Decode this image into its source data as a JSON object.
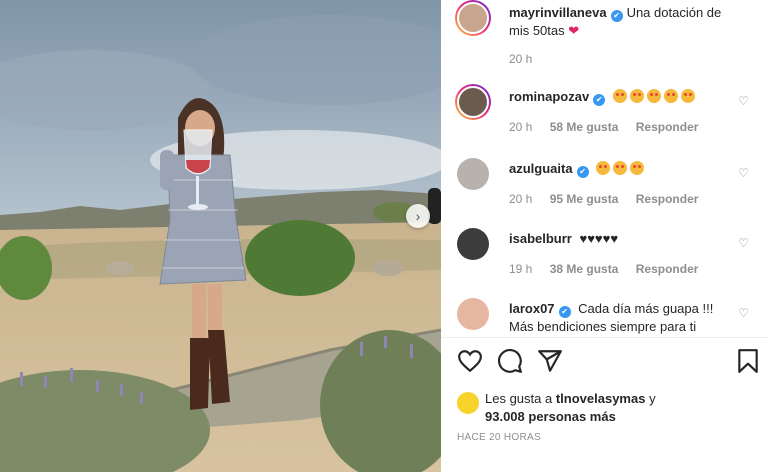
{
  "post": {
    "author": "mayrinvillaneva",
    "caption": "Una dotación de mis 50tas",
    "caption_emoji": "❤",
    "time": "20 h"
  },
  "comments": [
    {
      "user": "rominapozav",
      "text": "",
      "emoji_count": 5,
      "time": "20 h",
      "likes": "58 Me gusta",
      "reply": "Responder"
    },
    {
      "user": "azulguaita",
      "text": "",
      "emoji_count": 3,
      "time": "20 h",
      "likes": "95 Me gusta",
      "reply": "Responder"
    },
    {
      "user": "isabelburr",
      "text": "♥♥♥♥♥",
      "emoji_count": 0,
      "time": "19 h",
      "likes": "38 Me gusta",
      "reply": "Responder"
    },
    {
      "user": "larox07",
      "text": "Cada día más guapa !!! Más bendiciones siempre para ti",
      "emoji_count": 0,
      "time": "",
      "likes": "",
      "reply": ""
    }
  ],
  "likes": {
    "prefix": "Les gusta a",
    "user": "tlnovelasymas",
    "conj": "y",
    "others": "93.008 personas más"
  },
  "footer_time": "HACE 20 HORAS",
  "icons": {
    "like": "heart-icon",
    "comment": "comment-icon",
    "share": "share-icon",
    "save": "bookmark-icon",
    "next": "chevron-right-icon"
  },
  "colors": {
    "verified": "#3897f0",
    "heart": "#e0245e"
  }
}
